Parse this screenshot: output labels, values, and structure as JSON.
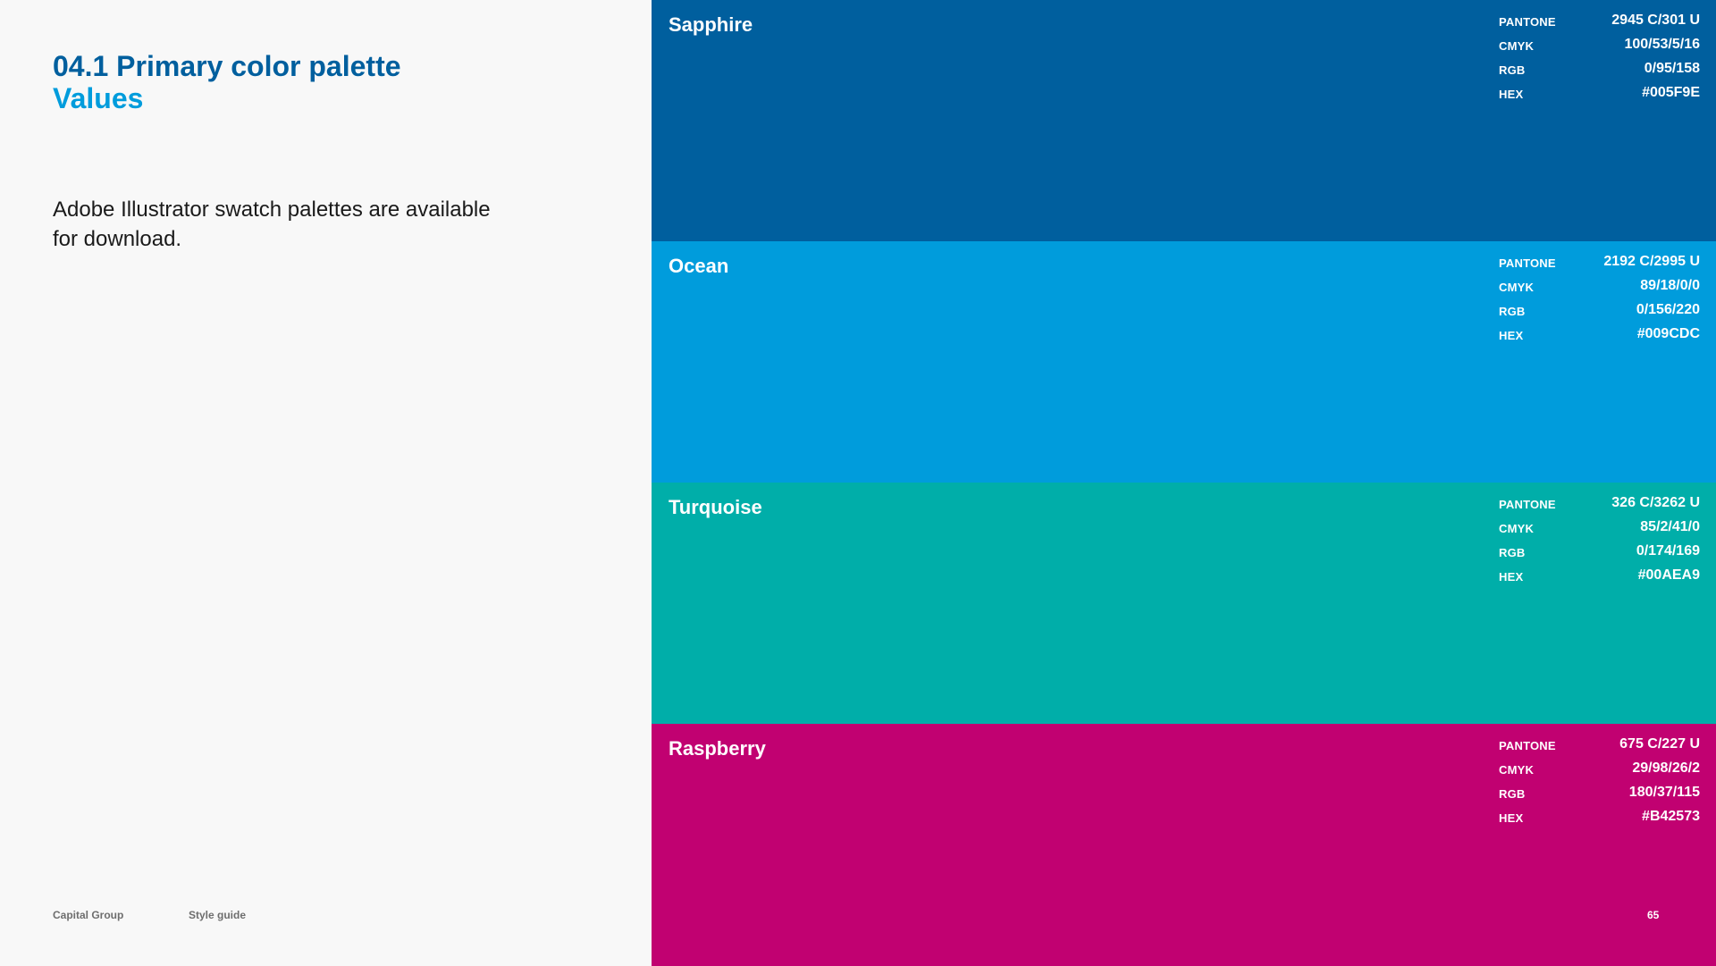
{
  "heading": {
    "line1": "04.1 Primary color palette",
    "line2": "Values"
  },
  "description": "Adobe Illustrator swatch palettes are available for download.",
  "footer": {
    "brand": "Capital Group",
    "document": "Style guide",
    "page_number": "65"
  },
  "labels": {
    "pantone": "PANTONE",
    "cmyk": "CMYK",
    "rgb": "RGB",
    "hex": "HEX"
  },
  "swatches": [
    {
      "name": "Sapphire",
      "color": "#005F9E",
      "pantone": "2945 C/301 U",
      "cmyk": "100/53/5/16",
      "rgb": "0/95/158",
      "hex": "#005F9E"
    },
    {
      "name": "Ocean",
      "color": "#009CDC",
      "pantone": "2192 C/2995 U",
      "cmyk": "89/18/0/0",
      "rgb": "0/156/220",
      "hex": "#009CDC"
    },
    {
      "name": "Turquoise",
      "color": "#00AEA9",
      "pantone": "326 C/3262 U",
      "cmyk": "85/2/41/0",
      "rgb": "0/174/169",
      "hex": "#00AEA9"
    },
    {
      "name": "Raspberry",
      "color": "#C10171",
      "pantone": "675 C/227 U",
      "cmyk": "29/98/26/2",
      "rgb": "180/37/115",
      "hex": "#B42573"
    }
  ]
}
